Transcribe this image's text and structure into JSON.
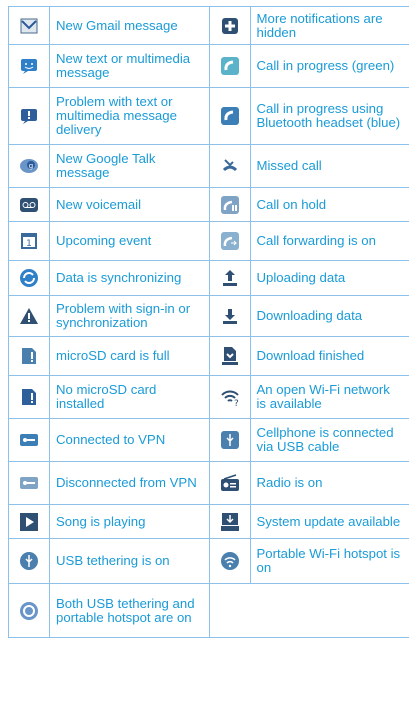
{
  "rows": [
    {
      "h": 37,
      "left": {
        "icon": "gmail-icon",
        "text": "New Gmail message"
      },
      "right": {
        "icon": "more-notifications-icon",
        "text": "More notifications are hidden"
      }
    },
    {
      "h": 42,
      "left": {
        "icon": "sms-icon",
        "text": "New text or multimedia message"
      },
      "right": {
        "icon": "call-green-icon",
        "text": "Call in progress (green)"
      }
    },
    {
      "h": 56,
      "left": {
        "icon": "sms-problem-icon",
        "text": "Problem with text or multimedia message delivery"
      },
      "right": {
        "icon": "call-bluetooth-icon",
        "text": "Call in progress using Bluetooth headset (blue)"
      }
    },
    {
      "h": 42,
      "left": {
        "icon": "talk-icon",
        "text": "New Google Talk message"
      },
      "right": {
        "icon": "missed-call-icon",
        "text": "Missed call"
      }
    },
    {
      "h": 33,
      "left": {
        "icon": "voicemail-icon",
        "text": "New voicemail"
      },
      "right": {
        "icon": "call-hold-icon",
        "text": "Call on hold"
      }
    },
    {
      "h": 38,
      "left": {
        "icon": "calendar-icon",
        "text": "Upcoming event"
      },
      "right": {
        "icon": "call-forward-icon",
        "text": "Call forwarding is on"
      }
    },
    {
      "h": 34,
      "left": {
        "icon": "sync-icon",
        "text": "Data is synchronizing"
      },
      "right": {
        "icon": "upload-icon",
        "text": "Uploading data"
      }
    },
    {
      "h": 40,
      "left": {
        "icon": "warning-icon",
        "text": "Problem with sign-in or synchronization"
      },
      "right": {
        "icon": "download-icon",
        "text": "Downloading data"
      }
    },
    {
      "h": 38,
      "left": {
        "icon": "sd-full-icon",
        "text": "microSD card is full"
      },
      "right": {
        "icon": "download-finished-icon",
        "text": "Download finished"
      }
    },
    {
      "h": 42,
      "left": {
        "icon": "no-sd-icon",
        "text": "No microSD card installed"
      },
      "right": {
        "icon": "open-wifi-icon",
        "text": "An open Wi-Fi network is available"
      }
    },
    {
      "h": 42,
      "left": {
        "icon": "vpn-icon",
        "text": "Connected to VPN"
      },
      "right": {
        "icon": "usb-icon",
        "text": "Cellphone is connected via USB cable"
      }
    },
    {
      "h": 42,
      "left": {
        "icon": "vpn-off-icon",
        "text": "Disconnected from VPN"
      },
      "right": {
        "icon": "radio-icon",
        "text": "Radio is on"
      }
    },
    {
      "h": 33,
      "left": {
        "icon": "play-icon",
        "text": "Song is playing"
      },
      "right": {
        "icon": "system-update-icon",
        "text": "System update available"
      }
    },
    {
      "h": 44,
      "left": {
        "icon": "usb-tether-icon",
        "text": "USB tethering is on"
      },
      "right": {
        "icon": "hotspot-icon",
        "text": "Portable Wi-Fi hotspot is on"
      }
    },
    {
      "h": 53,
      "left": {
        "icon": "usb-hotspot-icon",
        "text": "Both USB tethering and portable hotspot are on"
      },
      "right": null
    }
  ]
}
